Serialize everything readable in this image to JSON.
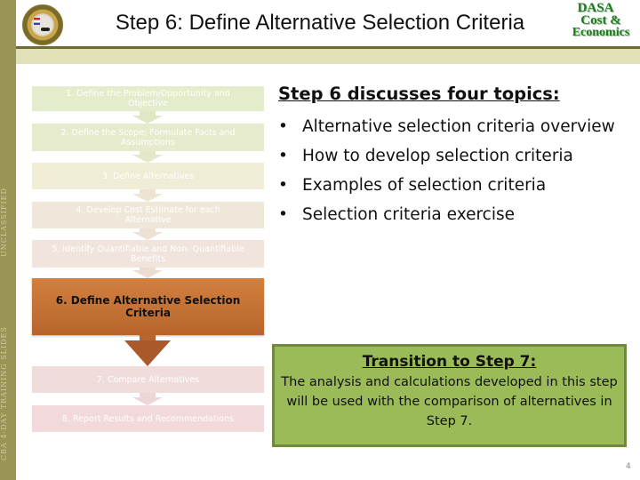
{
  "header": {
    "title": "Step 6: Define Alternative Selection Criteria",
    "logo_left": "army-seal-icon",
    "logo_right": {
      "line1": "DASA",
      "line2": "Cost &",
      "line3": "Economics"
    }
  },
  "sidebar": {
    "classification": "UNCLASSIFIED",
    "course": "CBA 4-DAY TRAINING SLIDES"
  },
  "steps": [
    {
      "label": "1. Define the Problem/Opportunity and Objective",
      "color": "#e3eccb",
      "active": false
    },
    {
      "label": "2. Define the Scope; Formulate Facts and Assumptions",
      "color": "#e6ebcd",
      "active": false
    },
    {
      "label": "3. Define Alternatives",
      "color": "#efedd6",
      "active": false
    },
    {
      "label": "4. Develop Cost Estimate for each Alternative",
      "color": "#efe8da",
      "active": false
    },
    {
      "label": "5. Identify Quantifiable and Non- Quantifiable Benefits",
      "color": "#f0e4dc",
      "active": false
    },
    {
      "label": "6. Define Alternative Selection Criteria",
      "color": "#cc7a3e",
      "active": true
    },
    {
      "label": "7.  Compare Alternatives",
      "color": "#f1dcdc",
      "active": false
    },
    {
      "label": "8.  Report Results and Recommendations",
      "color": "#f1d9dc",
      "active": false
    }
  ],
  "topics": {
    "heading": "Step 6 discusses four topics:",
    "bullet": "•",
    "items": [
      "Alternative selection criteria overview",
      "How to develop selection criteria",
      "Examples of selection criteria",
      "Selection criteria exercise"
    ]
  },
  "transition": {
    "heading": "Transition to Step 7:",
    "body": "The analysis and calculations developed in this step will be used with the comparison of alternatives in Step 7.",
    "background": "#9bbb59"
  },
  "page_number": "4"
}
